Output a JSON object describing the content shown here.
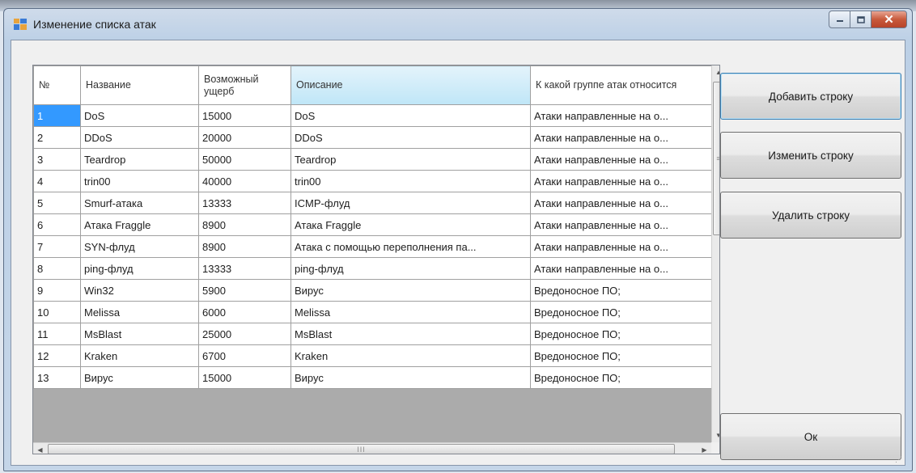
{
  "window": {
    "title": "Изменение списка атак",
    "controls": {
      "minimize_icon": "minimize-icon",
      "maximize_icon": "maximize-icon",
      "close_icon": "close-icon"
    }
  },
  "grid": {
    "columns": [
      "№",
      "Название",
      "Возможный ущерб",
      "Описание",
      "К какой группе атак относится"
    ],
    "selected_column": 3,
    "selected_row": 0,
    "rows": [
      {
        "num": "1",
        "name": "DoS",
        "damage": "15000",
        "desc": "DoS",
        "group": "Атаки направленные на о..."
      },
      {
        "num": "2",
        "name": "DDoS",
        "damage": "20000",
        "desc": "DDoS",
        "group": "Атаки направленные на о..."
      },
      {
        "num": "3",
        "name": "Teardrop",
        "damage": "50000",
        "desc": "Teardrop",
        "group": "Атаки направленные на о..."
      },
      {
        "num": "4",
        "name": "trin00",
        "damage": "40000",
        "desc": "trin00",
        "group": "Атаки направленные на о..."
      },
      {
        "num": "5",
        "name": "Smurf-атака",
        "damage": "13333",
        "desc": "ICMP-флуд",
        "group": "Атаки направленные на о..."
      },
      {
        "num": "6",
        "name": "Атака Fraggle",
        "damage": "8900",
        "desc": "Атака Fraggle",
        "group": "Атаки направленные на о..."
      },
      {
        "num": "7",
        "name": "SYN-флуд",
        "damage": "8900",
        "desc": "Атака с помощью переполнения па...",
        "group": "Атаки направленные на о..."
      },
      {
        "num": "8",
        "name": "ping-флуд",
        "damage": "13333",
        "desc": "ping-флуд",
        "group": "Атаки направленные на о..."
      },
      {
        "num": "9",
        "name": "Win32",
        "damage": "5900",
        "desc": "Вирус",
        "group": "Вредоносное ПО;"
      },
      {
        "num": "10",
        "name": "Melissa",
        "damage": "6000",
        "desc": "Melissa",
        "group": "Вредоносное ПО;"
      },
      {
        "num": "11",
        "name": "MsBlast",
        "damage": "25000",
        "desc": "MsBlast",
        "group": "Вредоносное ПО;"
      },
      {
        "num": "12",
        "name": "Kraken",
        "damage": "6700",
        "desc": "Kraken",
        "group": "Вредоносное ПО;"
      },
      {
        "num": "13",
        "name": "Вирус",
        "damage": "15000",
        "desc": "Вирус",
        "group": "Вредоносное ПО;"
      }
    ],
    "hscroll_grip": "III"
  },
  "buttons": {
    "add_row": "Добавить строку",
    "edit_row": "Изменить строку",
    "delete_row": "Удалить строку",
    "ok": "Ок"
  },
  "colors": {
    "selection": "#3399ff",
    "header_selected": "#bfe6f7",
    "close_button": "#c85a3c"
  }
}
